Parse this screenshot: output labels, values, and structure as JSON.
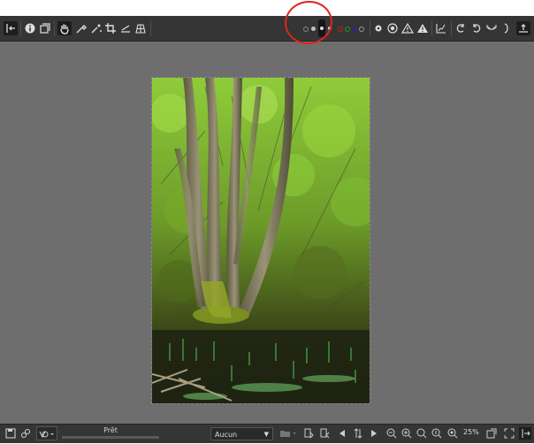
{
  "toolbar": {
    "left_icons": [
      "panel-toggle-icon",
      "info-icon",
      "history-icon",
      "hand-icon",
      "color-picker-icon",
      "white-balance-icon",
      "crop-icon",
      "straighten-icon",
      "perspective-icon"
    ],
    "right_icons": [
      "clipping-indicator-icon",
      "focus-mask-icon",
      "warning-icon",
      "warning-filled-icon",
      "histogram-icon",
      "rotate-left-icon",
      "rotate-right-icon",
      "flip-icon",
      "flip-vertical-icon",
      "detail-panel-toggle-icon"
    ],
    "channel_dots": [
      "#888888",
      "#c0c0c0",
      "#c81e1e",
      "#1e9e1e",
      "#2323c8",
      "#9a9a9a"
    ]
  },
  "status": {
    "label": "Prêt"
  },
  "profile_select": {
    "value": "Aucun"
  },
  "zoom": {
    "level": "25%"
  },
  "annotation": {
    "color": "#e0241b"
  }
}
